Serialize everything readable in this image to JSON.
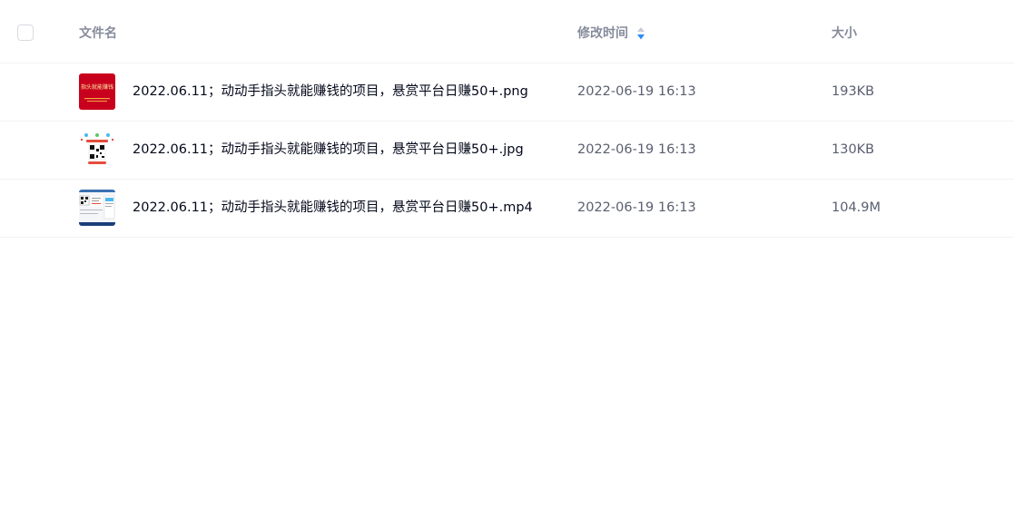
{
  "header": {
    "name_label": "文件名",
    "time_label": "修改时间",
    "size_label": "大小"
  },
  "files": [
    {
      "name": "2022.06.11；动动手指头就能赚钱的项目，悬赏平台日赚50+.png",
      "modified": "2022-06-19 16:13",
      "size": "193KB",
      "thumb_text": "指头就能赚钱"
    },
    {
      "name": "2022.06.11；动动手指头就能赚钱的项目，悬赏平台日赚50+.jpg",
      "modified": "2022-06-19 16:13",
      "size": "130KB"
    },
    {
      "name": "2022.06.11；动动手指头就能赚钱的项目，悬赏平台日赚50+.mp4",
      "modified": "2022-06-19 16:13",
      "size": "104.9M"
    }
  ],
  "colors": {
    "sort_active": "#2b8cf7",
    "sort_inactive": "#c6cbd4",
    "thumb_red": "#c8001e"
  }
}
